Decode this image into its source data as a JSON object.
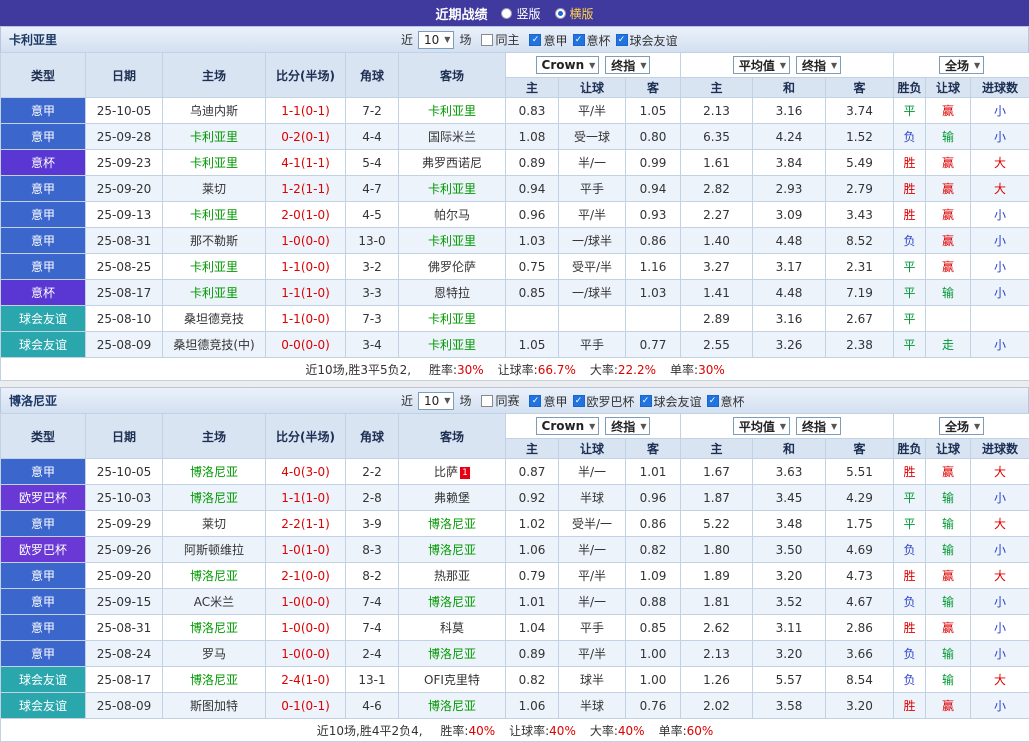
{
  "topbar": {
    "title": "近期战绩",
    "vertical_label": "竖版",
    "horizontal_label": "横版"
  },
  "columns": {
    "type": "类型",
    "date": "日期",
    "home": "主场",
    "score": "比分(半场)",
    "corner": "角球",
    "away": "客场",
    "asian_home": "主",
    "asian_line": "让球",
    "asian_away": "客",
    "euro_home": "主",
    "euro_draw": "和",
    "euro_away": "客",
    "result": "胜负",
    "cover": "让球",
    "goals": "进球数"
  },
  "colors": {
    "topbar_bg": "#413a9e",
    "focus_team": "#009900",
    "score": "#dd0000",
    "leagues": {
      "意甲": "#3b66cc",
      "意杯": "#5a36d2",
      "欧罗巴杯": "#6a38d4",
      "球会友谊": "#2aa7ad"
    },
    "outcomes": {
      "胜": "#dd0000",
      "平": "#009933",
      "负": "#2e44cc",
      "赢": "#dd0000",
      "输": "#009933",
      "走": "#009933",
      "大": "#dd0000",
      "小": "#2e44cc"
    }
  },
  "sections": [
    {
      "team": "卡利亚里",
      "filter": {
        "near_label": "近",
        "count": "10",
        "games_label": "场",
        "same_label": "同主",
        "leagues": [
          "意甲",
          "意杯",
          "球会友谊"
        ]
      },
      "dropdowns": {
        "book": "Crown",
        "book_index": "终指",
        "euro": "平均值",
        "euro_index": "终指",
        "scope": "全场"
      },
      "rows": [
        {
          "league": "意甲",
          "date": "25-10-05",
          "home": "乌迪内斯",
          "home_focus": false,
          "score": "1-1(0-1)",
          "corner": "7-2",
          "away": "卡利亚里",
          "away_focus": true,
          "ah_home": "0.83",
          "ah_line": "平/半",
          "ah_away": "1.05",
          "eu_home": "2.13",
          "eu_draw": "3.16",
          "eu_away": "3.74",
          "result": "平",
          "cover": "赢",
          "goals": "小"
        },
        {
          "league": "意甲",
          "date": "25-09-28",
          "home": "卡利亚里",
          "home_focus": true,
          "score": "0-2(0-1)",
          "corner": "4-4",
          "away": "国际米兰",
          "away_focus": false,
          "ah_home": "1.08",
          "ah_line": "受一球",
          "ah_away": "0.80",
          "eu_home": "6.35",
          "eu_draw": "4.24",
          "eu_away": "1.52",
          "result": "负",
          "cover": "输",
          "goals": "小"
        },
        {
          "league": "意杯",
          "date": "25-09-23",
          "home": "卡利亚里",
          "home_focus": true,
          "score": "4-1(1-1)",
          "corner": "5-4",
          "away": "弗罗西诺尼",
          "away_focus": false,
          "ah_home": "0.89",
          "ah_line": "半/一",
          "ah_away": "0.99",
          "eu_home": "1.61",
          "eu_draw": "3.84",
          "eu_away": "5.49",
          "result": "胜",
          "cover": "赢",
          "goals": "大"
        },
        {
          "league": "意甲",
          "date": "25-09-20",
          "home": "莱切",
          "home_focus": false,
          "score": "1-2(1-1)",
          "corner": "4-7",
          "away": "卡利亚里",
          "away_focus": true,
          "ah_home": "0.94",
          "ah_line": "平手",
          "ah_away": "0.94",
          "eu_home": "2.82",
          "eu_draw": "2.93",
          "eu_away": "2.79",
          "result": "胜",
          "cover": "赢",
          "goals": "大"
        },
        {
          "league": "意甲",
          "date": "25-09-13",
          "home": "卡利亚里",
          "home_focus": true,
          "score": "2-0(1-0)",
          "corner": "4-5",
          "away": "帕尔马",
          "away_focus": false,
          "ah_home": "0.96",
          "ah_line": "平/半",
          "ah_away": "0.93",
          "eu_home": "2.27",
          "eu_draw": "3.09",
          "eu_away": "3.43",
          "result": "胜",
          "cover": "赢",
          "goals": "小"
        },
        {
          "league": "意甲",
          "date": "25-08-31",
          "home": "那不勒斯",
          "home_focus": false,
          "score": "1-0(0-0)",
          "corner": "13-0",
          "away": "卡利亚里",
          "away_focus": true,
          "ah_home": "1.03",
          "ah_line": "一/球半",
          "ah_away": "0.86",
          "eu_home": "1.40",
          "eu_draw": "4.48",
          "eu_away": "8.52",
          "result": "负",
          "cover": "赢",
          "goals": "小"
        },
        {
          "league": "意甲",
          "date": "25-08-25",
          "home": "卡利亚里",
          "home_focus": true,
          "score": "1-1(0-0)",
          "corner": "3-2",
          "away": "佛罗伦萨",
          "away_focus": false,
          "ah_home": "0.75",
          "ah_line": "受平/半",
          "ah_away": "1.16",
          "eu_home": "3.27",
          "eu_draw": "3.17",
          "eu_away": "2.31",
          "result": "平",
          "cover": "赢",
          "goals": "小"
        },
        {
          "league": "意杯",
          "date": "25-08-17",
          "home": "卡利亚里",
          "home_focus": true,
          "score": "1-1(1-0)",
          "corner": "3-3",
          "away": "恩特拉",
          "away_focus": false,
          "ah_home": "0.85",
          "ah_line": "一/球半",
          "ah_away": "1.03",
          "eu_home": "1.41",
          "eu_draw": "4.48",
          "eu_away": "7.19",
          "result": "平",
          "cover": "输",
          "goals": "小"
        },
        {
          "league": "球会友谊",
          "date": "25-08-10",
          "home": "桑坦德竞技",
          "home_focus": false,
          "score": "1-1(0-0)",
          "corner": "7-3",
          "away": "卡利亚里",
          "away_focus": true,
          "ah_home": "",
          "ah_line": "",
          "ah_away": "",
          "eu_home": "2.89",
          "eu_draw": "3.16",
          "eu_away": "2.67",
          "result": "平",
          "cover": "",
          "goals": ""
        },
        {
          "league": "球会友谊",
          "date": "25-08-09",
          "home": "桑坦德竞技(中)",
          "home_focus": false,
          "score": "0-0(0-0)",
          "corner": "3-4",
          "away": "卡利亚里",
          "away_focus": true,
          "ah_home": "1.05",
          "ah_line": "平手",
          "ah_away": "0.77",
          "eu_home": "2.55",
          "eu_draw": "3.26",
          "eu_away": "2.38",
          "result": "平",
          "cover": "走",
          "goals": "小"
        }
      ],
      "summary": {
        "prefix": "近10场,胜3平5负2,",
        "stats": [
          {
            "label": "胜率:",
            "value": "30%"
          },
          {
            "label": "让球率:",
            "value": "66.7%"
          },
          {
            "label": "大率:",
            "value": "22.2%"
          },
          {
            "label": "单率:",
            "value": "30%"
          }
        ]
      }
    },
    {
      "team": "博洛尼亚",
      "filter": {
        "near_label": "近",
        "count": "10",
        "games_label": "场",
        "same_label": "同赛",
        "leagues": [
          "意甲",
          "欧罗巴杯",
          "球会友谊",
          "意杯"
        ]
      },
      "dropdowns": {
        "book": "Crown",
        "book_index": "终指",
        "euro": "平均值",
        "euro_index": "终指",
        "scope": "全场"
      },
      "rows": [
        {
          "league": "意甲",
          "date": "25-10-05",
          "home": "博洛尼亚",
          "home_focus": true,
          "score": "4-0(3-0)",
          "corner": "2-2",
          "away": "比萨",
          "away_focus": false,
          "away_badge": "1",
          "ah_home": "0.87",
          "ah_line": "半/一",
          "ah_away": "1.01",
          "eu_home": "1.67",
          "eu_draw": "3.63",
          "eu_away": "5.51",
          "result": "胜",
          "cover": "赢",
          "goals": "大"
        },
        {
          "league": "欧罗巴杯",
          "date": "25-10-03",
          "home": "博洛尼亚",
          "home_focus": true,
          "score": "1-1(1-0)",
          "corner": "2-8",
          "away": "弗赖堡",
          "away_focus": false,
          "ah_home": "0.92",
          "ah_line": "半球",
          "ah_away": "0.96",
          "eu_home": "1.87",
          "eu_draw": "3.45",
          "eu_away": "4.29",
          "result": "平",
          "cover": "输",
          "goals": "小"
        },
        {
          "league": "意甲",
          "date": "25-09-29",
          "home": "莱切",
          "home_focus": false,
          "score": "2-2(1-1)",
          "corner": "3-9",
          "away": "博洛尼亚",
          "away_focus": true,
          "ah_home": "1.02",
          "ah_line": "受半/一",
          "ah_away": "0.86",
          "eu_home": "5.22",
          "eu_draw": "3.48",
          "eu_away": "1.75",
          "result": "平",
          "cover": "输",
          "goals": "大"
        },
        {
          "league": "欧罗巴杯",
          "date": "25-09-26",
          "home": "阿斯顿维拉",
          "home_focus": false,
          "score": "1-0(1-0)",
          "corner": "8-3",
          "away": "博洛尼亚",
          "away_focus": true,
          "ah_home": "1.06",
          "ah_line": "半/一",
          "ah_away": "0.82",
          "eu_home": "1.80",
          "eu_draw": "3.50",
          "eu_away": "4.69",
          "result": "负",
          "cover": "输",
          "goals": "小"
        },
        {
          "league": "意甲",
          "date": "25-09-20",
          "home": "博洛尼亚",
          "home_focus": true,
          "score": "2-1(0-0)",
          "corner": "8-2",
          "away": "热那亚",
          "away_focus": false,
          "ah_home": "0.79",
          "ah_line": "平/半",
          "ah_away": "1.09",
          "eu_home": "1.89",
          "eu_draw": "3.20",
          "eu_away": "4.73",
          "result": "胜",
          "cover": "赢",
          "goals": "大"
        },
        {
          "league": "意甲",
          "date": "25-09-15",
          "home": "AC米兰",
          "home_focus": false,
          "score": "1-0(0-0)",
          "corner": "7-4",
          "away": "博洛尼亚",
          "away_focus": true,
          "ah_home": "1.01",
          "ah_line": "半/一",
          "ah_away": "0.88",
          "eu_home": "1.81",
          "eu_draw": "3.52",
          "eu_away": "4.67",
          "result": "负",
          "cover": "输",
          "goals": "小"
        },
        {
          "league": "意甲",
          "date": "25-08-31",
          "home": "博洛尼亚",
          "home_focus": true,
          "score": "1-0(0-0)",
          "corner": "7-4",
          "away": "科莫",
          "away_focus": false,
          "ah_home": "1.04",
          "ah_line": "平手",
          "ah_away": "0.85",
          "eu_home": "2.62",
          "eu_draw": "3.11",
          "eu_away": "2.86",
          "result": "胜",
          "cover": "赢",
          "goals": "小"
        },
        {
          "league": "意甲",
          "date": "25-08-24",
          "home": "罗马",
          "home_focus": false,
          "score": "1-0(0-0)",
          "corner": "2-4",
          "away": "博洛尼亚",
          "away_focus": true,
          "ah_home": "0.89",
          "ah_line": "平/半",
          "ah_away": "1.00",
          "eu_home": "2.13",
          "eu_draw": "3.20",
          "eu_away": "3.66",
          "result": "负",
          "cover": "输",
          "goals": "小"
        },
        {
          "league": "球会友谊",
          "date": "25-08-17",
          "home": "博洛尼亚",
          "home_focus": true,
          "score": "2-4(1-0)",
          "corner": "13-1",
          "away": "OFI克里特",
          "away_focus": false,
          "ah_home": "0.82",
          "ah_line": "球半",
          "ah_away": "1.00",
          "eu_home": "1.26",
          "eu_draw": "5.57",
          "eu_away": "8.54",
          "result": "负",
          "cover": "输",
          "goals": "大"
        },
        {
          "league": "球会友谊",
          "date": "25-08-09",
          "home": "斯图加特",
          "home_focus": false,
          "score": "0-1(0-1)",
          "corner": "4-6",
          "away": "博洛尼亚",
          "away_focus": true,
          "ah_home": "1.06",
          "ah_line": "半球",
          "ah_away": "0.76",
          "eu_home": "2.02",
          "eu_draw": "3.58",
          "eu_away": "3.20",
          "result": "胜",
          "cover": "赢",
          "goals": "小"
        }
      ],
      "summary": {
        "prefix": "近10场,胜4平2负4,",
        "stats": [
          {
            "label": "胜率:",
            "value": "40%"
          },
          {
            "label": "让球率:",
            "value": "40%"
          },
          {
            "label": "大率:",
            "value": "40%"
          },
          {
            "label": "单率:",
            "value": "60%"
          }
        ]
      }
    }
  ]
}
